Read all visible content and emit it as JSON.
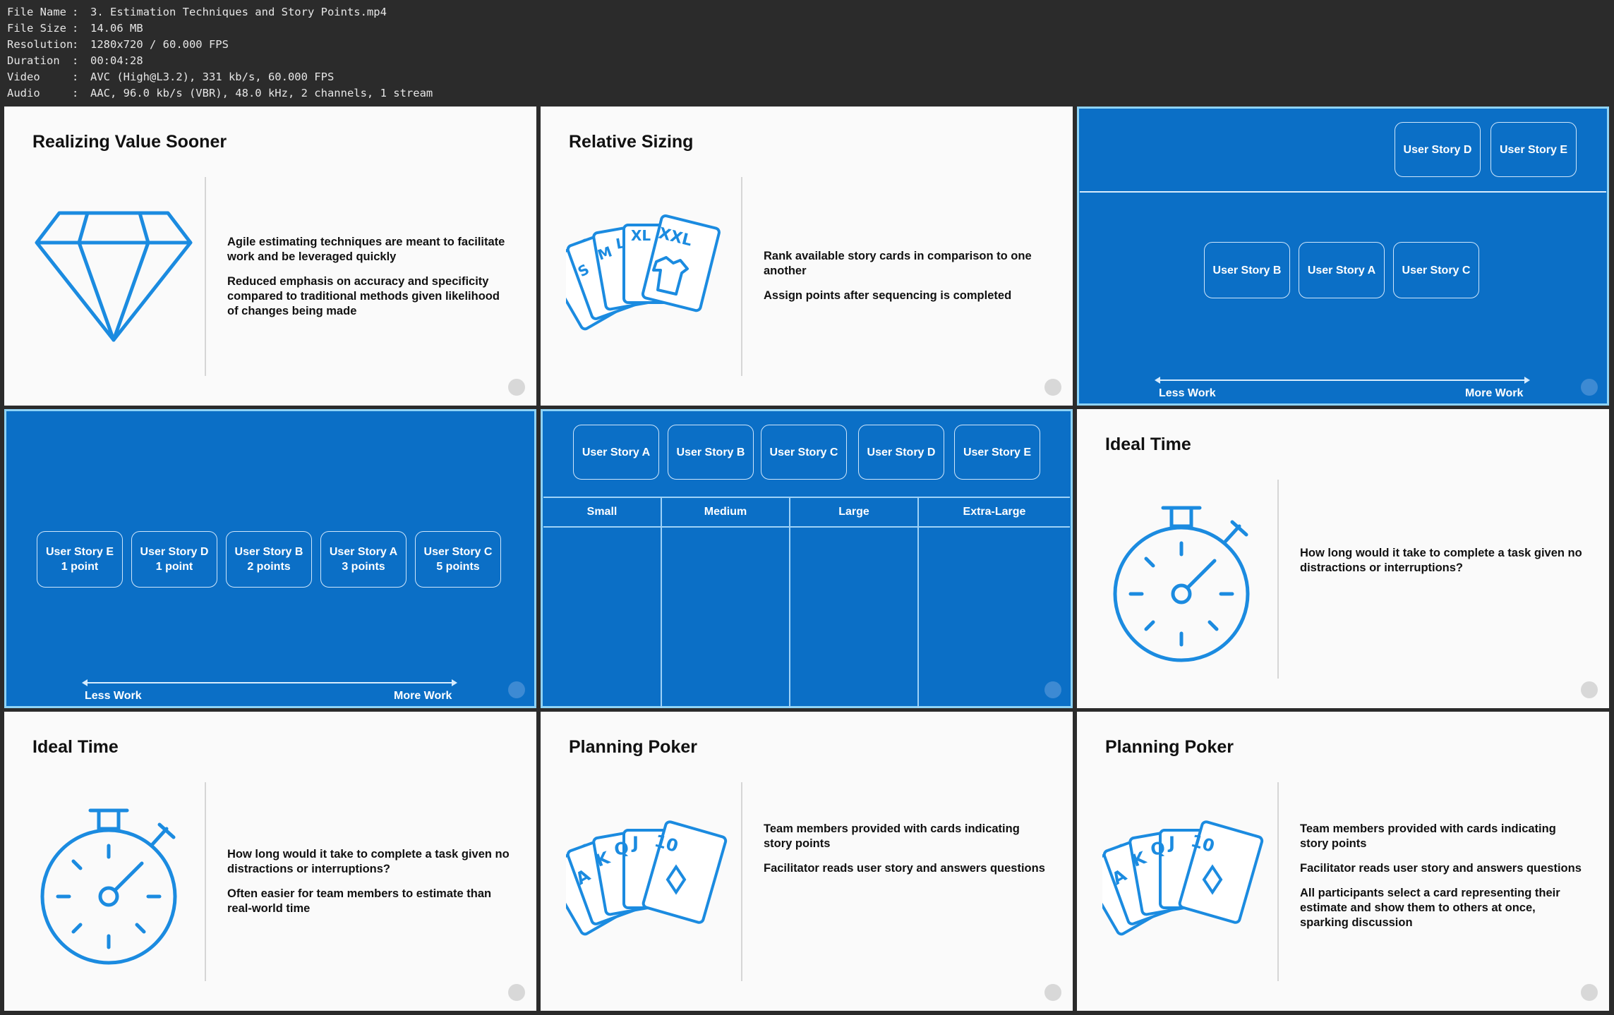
{
  "file_info": [
    {
      "key": "File Name",
      "value": "3. Estimation Techniques and Story Points.mp4"
    },
    {
      "key": "File Size",
      "value": "14.06 MB"
    },
    {
      "key": "Resolution",
      "value": "1280x720 / 60.000 FPS"
    },
    {
      "key": "Duration",
      "value": "00:04:28"
    },
    {
      "key": "Video",
      "value": "AVC (High@L3.2), 331 kb/s, 60.000 FPS"
    },
    {
      "key": "Audio",
      "value": "AAC, 96.0 kb/s (VBR), 48.0 kHz, 2 channels, 1 stream"
    }
  ],
  "separator": ":",
  "colors": {
    "blue": "#0b6fc6",
    "accent_icon": "#1b8be0",
    "text": "#111111",
    "background": "#2b2b2b"
  },
  "slides": {
    "s1": {
      "title": "Realizing Value Sooner",
      "icon": "diamond-icon",
      "p1": "Agile estimating techniques are meant to facilitate work and be leveraged quickly",
      "p2": "Reduced emphasis on accuracy and specificity compared to traditional methods given likelihood of changes being made"
    },
    "s2": {
      "title": "Relative Sizing",
      "icon": "tshirt-size-cards-icon",
      "p1": "Rank available story cards in comparison to one another",
      "p2": "Assign points after sequencing is completed",
      "card_labels": [
        "S",
        "M",
        "L",
        "XL",
        "XXL"
      ]
    },
    "s3": {
      "top_cards": [
        "User Story D",
        "User Story E"
      ],
      "mid_cards": [
        "User Story B",
        "User Story A",
        "User Story C"
      ],
      "less": "Less Work",
      "more": "More Work"
    },
    "s4": {
      "cards": [
        {
          "name": "User Story E",
          "points": "1 point"
        },
        {
          "name": "User Story D",
          "points": "1 point"
        },
        {
          "name": "User Story B",
          "points": "2 points"
        },
        {
          "name": "User Story A",
          "points": "3 points"
        },
        {
          "name": "User Story C",
          "points": "5 points"
        }
      ],
      "less": "Less Work",
      "more": "More Work"
    },
    "s5": {
      "cards": [
        "User Story A",
        "User Story B",
        "User Story C",
        "User Story D",
        "User Story E"
      ],
      "columns": [
        "Small",
        "Medium",
        "Large",
        "Extra-Large"
      ]
    },
    "s6": {
      "title": "Ideal Time",
      "icon": "stopwatch-icon",
      "p1": "How long would it take to complete a task given no distractions or interruptions?"
    },
    "s7": {
      "title": "Ideal Time",
      "icon": "stopwatch-icon",
      "p1": "How long would it take to complete a task given no distractions or interruptions?",
      "p2": "Often easier for team members to estimate than real-world time"
    },
    "s8": {
      "title": "Planning Poker",
      "icon": "playing-cards-icon",
      "p1": "Team members provided with cards indicating story points",
      "p2": "Facilitator reads user story and answers questions",
      "card_labels": [
        "A",
        "K",
        "Q",
        "J",
        "10"
      ]
    },
    "s9": {
      "title": "Planning Poker",
      "icon": "playing-cards-icon",
      "p1": "Team members provided with cards indicating story points",
      "p2": "Facilitator reads user story and answers questions",
      "p3": "All participants select a card representing their estimate and show them to others at once, sparking discussion",
      "card_labels": [
        "A",
        "K",
        "Q",
        "J",
        "10"
      ]
    }
  }
}
